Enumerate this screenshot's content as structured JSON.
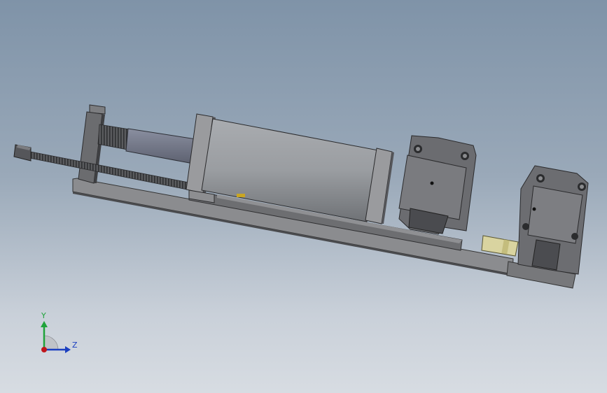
{
  "viewport": {
    "background_top": "#7f93a8",
    "background_bottom": "#d7dce2"
  },
  "model": {
    "body_color": "#8a8b8e",
    "dark_color": "#4e5054",
    "cylinder_color": "#9b9ea2",
    "accent_yellow": "#d9d4a0"
  },
  "triad": {
    "y_label": "Y",
    "z_label": "Z",
    "y_color": "#1fa33a",
    "z_color": "#1b3fc0",
    "x_color": "#c0161c"
  }
}
